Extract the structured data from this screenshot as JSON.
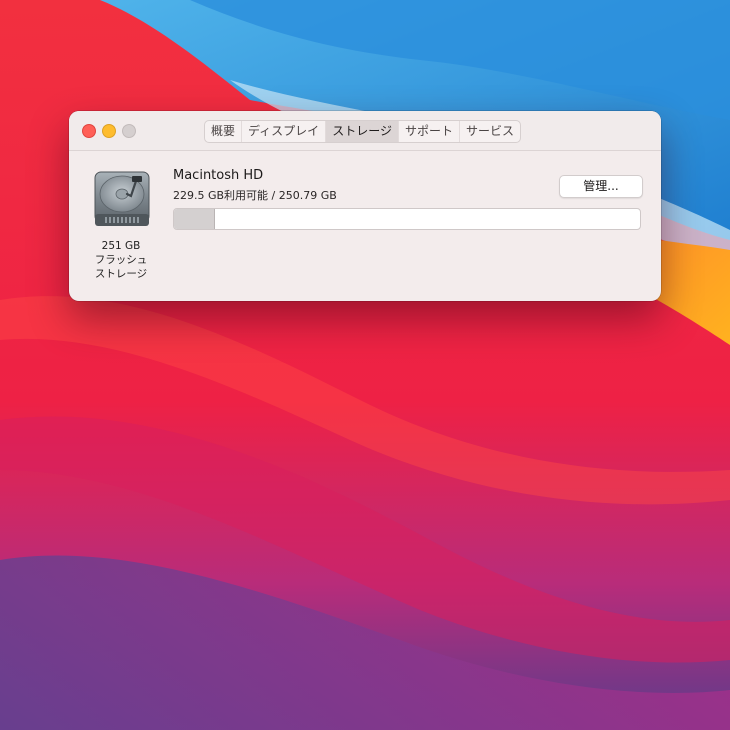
{
  "window": {
    "tabs": [
      {
        "label": "概要"
      },
      {
        "label": "ディスプレイ"
      },
      {
        "label": "ストレージ",
        "active": true
      },
      {
        "label": "サポート"
      },
      {
        "label": "サービス"
      }
    ]
  },
  "drive": {
    "icon": "hard-drive-icon",
    "capacity_label": "251 GB",
    "type_line1": "フラッシュ",
    "type_line2": "ストレージ"
  },
  "disk": {
    "name": "Macintosh HD",
    "available_text": "229.5 GB利用可能 / 250.79 GB",
    "used_fraction": 0.085
  },
  "buttons": {
    "manage_label": "管理..."
  },
  "colors": {
    "close": "#ff5f57",
    "minimize": "#febc2e",
    "zoom_disabled": "#d5cfcf"
  }
}
